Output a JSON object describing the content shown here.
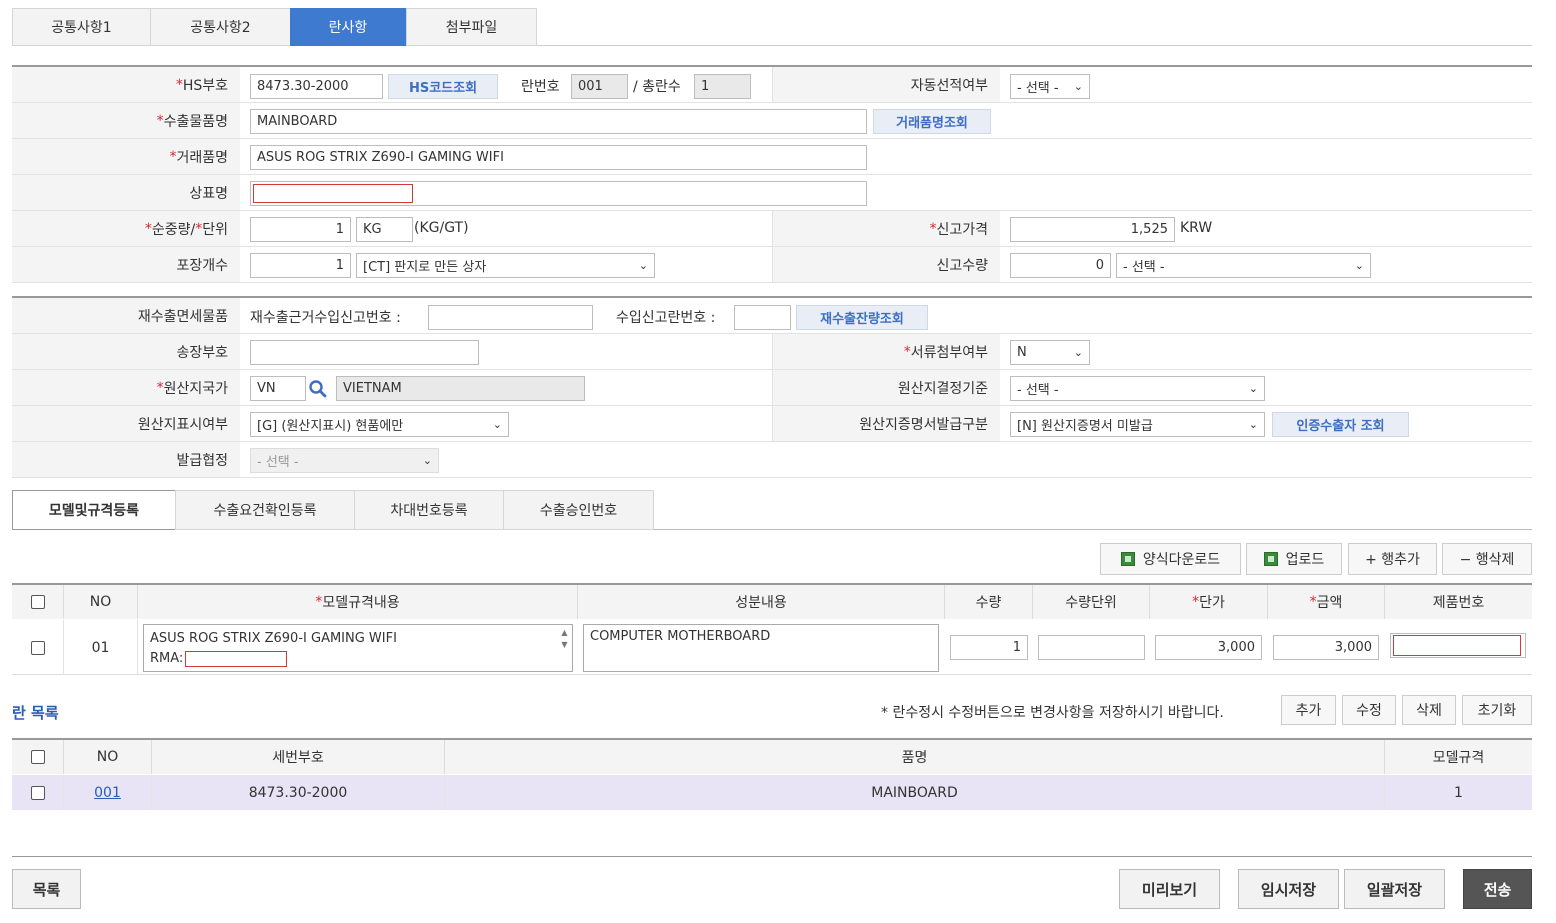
{
  "tabs_top": [
    "공통사항1",
    "공통사항2",
    "란사항",
    "첨부파일"
  ],
  "form": {
    "hs_label": "HS부호",
    "hs_value": "8473.30-2000",
    "hs_btn": "HS코드조회",
    "ran_no_label": "란번호",
    "ran_no": "001",
    "total_label": "/ 총란수",
    "total": "1",
    "auto_label": "자동선적여부",
    "auto_value": "- 선택 -",
    "item_label": "수출물품명",
    "item_value": "MAINBOARD",
    "item_btn": "거래품명조회",
    "trade_label": "거래품명",
    "trade_value": "ASUS ROG STRIX Z690-I GAMING WIFI",
    "brand_label": "상표명",
    "brand_value": "",
    "weight_label_a": "순중량/",
    "weight_label_b": "단위",
    "weight_value": "1",
    "weight_unit": "KG",
    "weight_note": "(KG/GT)",
    "price_label": "신고가격",
    "price_value": "1,525",
    "price_cur": "KRW",
    "pack_label": "포장개수",
    "pack_value": "1",
    "pack_type": "[CT] 판지로 만든 상자",
    "qty_label": "신고수량",
    "qty_value": "0",
    "qty_unit": "- 선택 -",
    "reexp_label": "재수출면세물품",
    "reexp_txt1": "재수출근거수입신고번호 :",
    "reexp_txt2": "수입신고란번호 :",
    "reexp_btn": "재수출잔량조회",
    "inv_label": "송장부호",
    "inv_value": "",
    "doc_label": "서류첨부여부",
    "doc_value": "N",
    "origin_label": "원산지국가",
    "origin_code": "VN",
    "origin_name": "VIETNAM",
    "origin_crit_label": "원산지결정기준",
    "origin_crit_value": "- 선택 -",
    "origin_mark_label": "원산지표시여부",
    "origin_mark_value": "[G] (원산지표시) 현품에만",
    "cert_label": "원산지증명서발급구분",
    "cert_value": "[N] 원산지증명서 미발급",
    "cert_btn": "인증수출자 조회",
    "agree_label": "발급협정",
    "agree_value": "- 선택 -"
  },
  "tabs_mid": [
    "모델및규격등록",
    "수출요건확인등록",
    "차대번호등록",
    "수출승인번호"
  ],
  "toolbar": {
    "download": "양식다운로드",
    "upload": "업로드",
    "add_row": "+ 행추가",
    "del_row": "− 행삭제"
  },
  "model_grid": {
    "headers": {
      "no": "NO",
      "model": "모델규격내용",
      "comp": "성분내용",
      "qty": "수량",
      "unit": "수량단위",
      "price": "단가",
      "amount": "금액",
      "prod": "제품번호"
    },
    "row": {
      "no": "01",
      "model": "ASUS ROG STRIX Z690-I GAMING WIFI",
      "rma": "RMA:",
      "comp": "COMPUTER MOTHERBOARD",
      "qty": "1",
      "unit": "",
      "price": "3,000",
      "amount": "3,000",
      "prod": ""
    }
  },
  "ran_list": {
    "title": "란 목록",
    "note": "* 란수정시 수정버튼으로 변경사항을 저장하시기 바랍니다.",
    "buttons": [
      "추가",
      "수정",
      "삭제",
      "초기화"
    ],
    "headers": {
      "no": "NO",
      "hs": "세번부호",
      "name": "품명",
      "model": "모델규격"
    },
    "row": {
      "no": "001",
      "hs": "8473.30-2000",
      "name": "MAINBOARD",
      "model": "1"
    }
  },
  "bottom": {
    "list": "목록",
    "preview": "미리보기",
    "temp_save": "임시저장",
    "bulk_save": "일괄저장",
    "send": "전송"
  }
}
